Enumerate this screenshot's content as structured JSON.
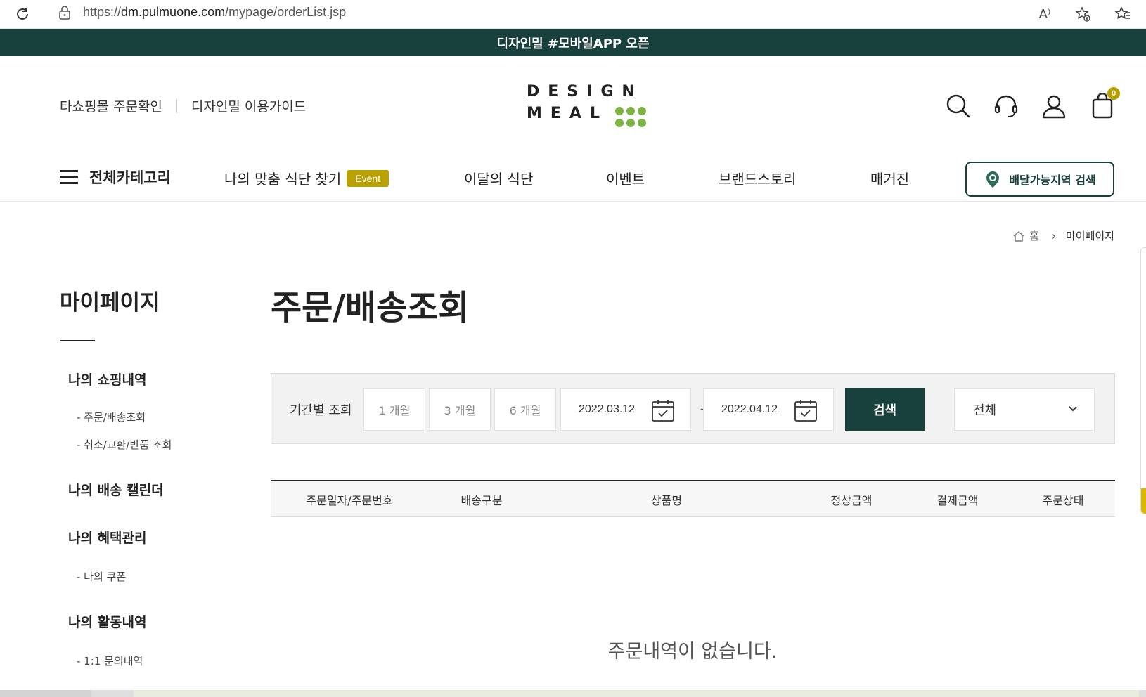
{
  "browser": {
    "url_prefix": "https://",
    "url_host": "dm.pulmuone.com",
    "url_path": "/mypage/orderList.jsp",
    "read_aloud_label": "A⁾"
  },
  "promo": {
    "text": "디자인밀 #모바일APP 오픈"
  },
  "header": {
    "util_links": [
      "타쇼핑몰 주문확인",
      "디자인밀 이용가이드"
    ],
    "logo_line1": "DESIGN",
    "logo_line2": "MEAL",
    "cart_count": "0"
  },
  "gnb": {
    "all_category": "전체카테고리",
    "items": [
      "나의 맞춤 식단 찾기",
      "이달의 식단",
      "이벤트",
      "브랜드스토리",
      "매거진"
    ],
    "event_badge": "Event",
    "delivery_search": "배달가능지역 검색"
  },
  "breadcrumb": {
    "home": "홈",
    "current": "마이페이지"
  },
  "sidebar": {
    "title": "마이페이지",
    "groups": [
      {
        "label": "나의 쇼핑내역",
        "subs": [
          "- 주문/배송조회",
          "- 취소/교환/반품 조회"
        ]
      },
      {
        "label": "나의 배송 캘린더",
        "subs": []
      },
      {
        "label": "나의 혜택관리",
        "subs": [
          "- 나의 쿠폰"
        ]
      },
      {
        "label": "나의 활동내역",
        "subs": [
          "- 1:1 문의내역"
        ]
      }
    ]
  },
  "main": {
    "title": "주문/배송조회",
    "filter": {
      "label": "기간별 조회",
      "periods": [
        "1 개월",
        "3 개월",
        "6 개월"
      ],
      "date_from": "2022.03.12",
      "date_to": "2022.04.12",
      "dash": "-",
      "search_label": "검색",
      "status_selected": "전체"
    },
    "table_columns": [
      "주문일자/주문번호",
      "배송구분",
      "상품명",
      "정상금액",
      "결제금액",
      "주문상태"
    ],
    "empty_message": "주문내역이 없습니다."
  },
  "colors": {
    "brand": "#18413d",
    "accent": "#b8a100",
    "logo_dots": "#7cb342"
  }
}
